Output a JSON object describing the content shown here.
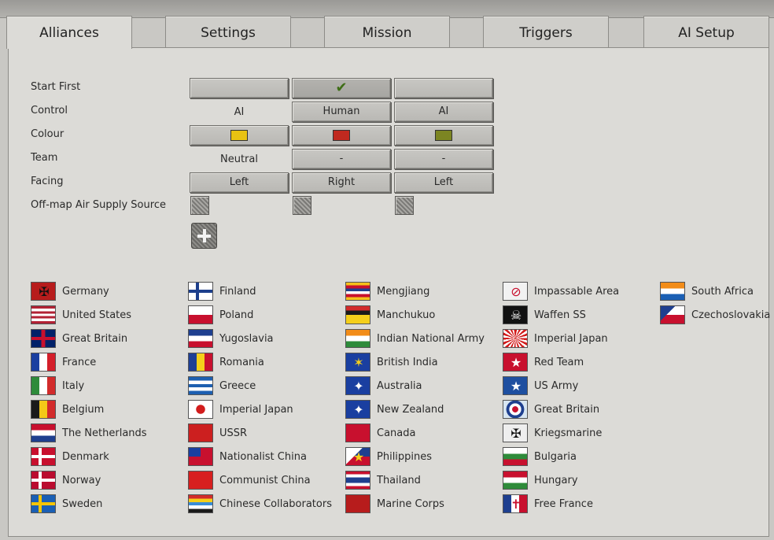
{
  "tabs": [
    {
      "label": "Alliances",
      "active": true
    },
    {
      "label": "Settings",
      "active": false
    },
    {
      "label": "Mission",
      "active": false
    },
    {
      "label": "Triggers",
      "active": false
    },
    {
      "label": "AI Setup",
      "active": false
    }
  ],
  "rows": {
    "start_first": "Start First",
    "control": "Control",
    "colour": "Colour",
    "team": "Team",
    "facing": "Facing",
    "air_supply": "Off-map Air Supply Source"
  },
  "sides": [
    {
      "start_first": false,
      "control": "AI",
      "colour": "#e8c212",
      "team": "Neutral",
      "facing": "Left",
      "air_supply": false
    },
    {
      "start_first": true,
      "control": "Human",
      "colour": "#c0291f",
      "team": "-",
      "facing": "Right",
      "air_supply": false
    },
    {
      "start_first": false,
      "control": "AI",
      "colour": "#7c8522",
      "team": "-",
      "facing": "Left",
      "air_supply": false
    }
  ],
  "icons": {
    "checkmark": "✔",
    "add": "add-side-icon"
  },
  "nations": [
    [
      "Germany",
      "United States",
      "Great Britain",
      "France",
      "Italy",
      "Belgium",
      "The Netherlands",
      "Denmark",
      "Norway",
      "Sweden"
    ],
    [
      "Finland",
      "Poland",
      "Yugoslavia",
      "Romania",
      "Greece",
      "Imperial Japan",
      "USSR",
      "Nationalist China",
      "Communist China",
      "Chinese Collaborators"
    ],
    [
      "Mengjiang",
      "Manchukuo",
      "Indian National Army",
      "British India",
      "Australia",
      "New Zealand",
      "Canada",
      "Philippines",
      "Thailand",
      "Marine Corps"
    ],
    [
      "Impassable Area",
      "Waffen SS",
      "Imperial Japan",
      "Red Team",
      "US Army",
      "Great Britain",
      "Kriegsmarine",
      "Bulgaria",
      "Hungary",
      "Free France"
    ],
    [
      "South Africa",
      "Czechoslovakia"
    ]
  ]
}
